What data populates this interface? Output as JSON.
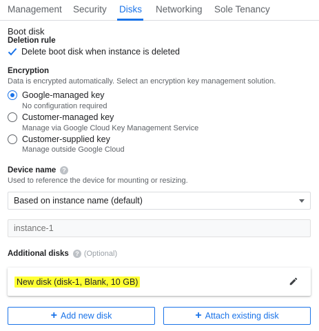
{
  "tabs": [
    {
      "label": "Management"
    },
    {
      "label": "Security"
    },
    {
      "label": "Disks",
      "active": true
    },
    {
      "label": "Networking"
    },
    {
      "label": "Sole Tenancy"
    }
  ],
  "boot_disk": {
    "title": "Boot disk",
    "deletion_rule": {
      "title": "Deletion rule",
      "checkbox_label": "Delete boot disk when instance is deleted",
      "checked": true
    }
  },
  "encryption": {
    "title": "Encryption",
    "description": "Data is encrypted automatically. Select an encryption key management solution.",
    "options": [
      {
        "label": "Google-managed key",
        "sub": "No configuration required",
        "selected": true
      },
      {
        "label": "Customer-managed key",
        "sub": "Manage via Google Cloud Key Management Service",
        "selected": false
      },
      {
        "label": "Customer-supplied key",
        "sub": "Manage outside Google Cloud",
        "selected": false
      }
    ]
  },
  "device_name": {
    "title": "Device name",
    "help_icon": "help-circle-icon",
    "description": "Used to reference the device for mounting or resizing.",
    "select_value": "Based on instance name (default)",
    "input_placeholder": "instance-1"
  },
  "additional_disks": {
    "title": "Additional disks",
    "optional": "(Optional)",
    "disks": [
      {
        "label": "New disk (disk-1, Blank, 10 GB)"
      }
    ],
    "highlight_color": "#ffff33"
  },
  "buttons": {
    "add_new_disk": "Add new disk",
    "attach_existing_disk": "Attach existing disk",
    "plus": "+"
  },
  "colors": {
    "accent": "#1a73e8",
    "text": "#202124",
    "muted": "#5f6368"
  }
}
